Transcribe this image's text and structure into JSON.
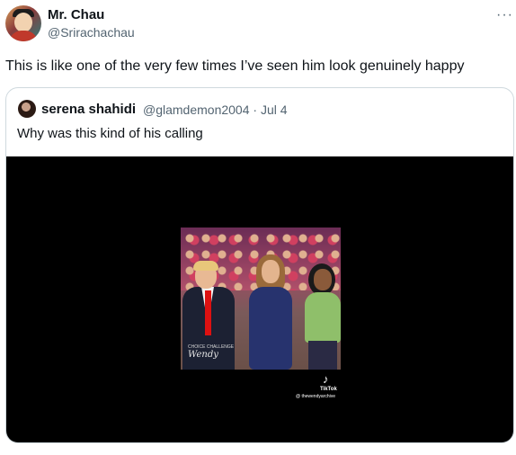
{
  "tweet": {
    "display_name": "Mr. Chau",
    "handle": "@Srirachachau",
    "text": "This is like one of the very few times I’ve seen him look genuinely happy",
    "more_icon": "ellipsis-icon"
  },
  "quote": {
    "display_name": "serena shahidi",
    "handle": "@glamdemon2004",
    "date": "Jul 4",
    "separator": "·",
    "text": "Why was this kind of his calling",
    "media": {
      "watermark_small": "CHOICE CHALLENGE",
      "watermark_big": "Wendy",
      "tiktok_icon": "♪",
      "tiktok_label": "TikTok",
      "tiktok_handle": "@ thewendyarchive"
    }
  },
  "colors": {
    "text": "#0f1419",
    "muted": "#536471",
    "border": "#cfd9de",
    "media_bg": "#000000"
  }
}
